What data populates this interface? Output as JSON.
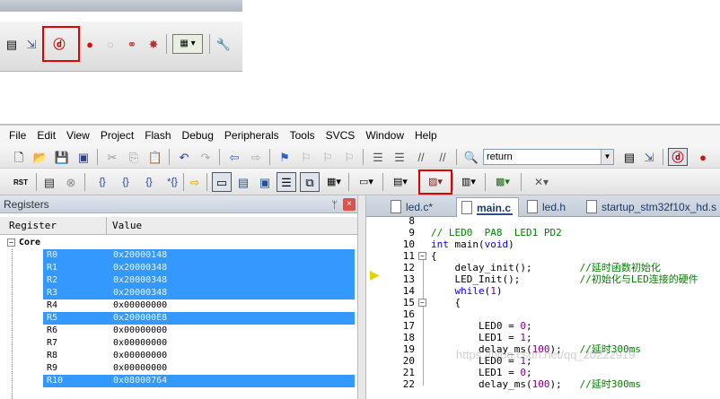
{
  "menubar": [
    "File",
    "Edit",
    "View",
    "Project",
    "Flash",
    "Debug",
    "Peripherals",
    "Tools",
    "SVCS",
    "Window",
    "Help"
  ],
  "toolbar": {
    "find_combo_value": "return",
    "rst_label": "RST"
  },
  "registers": {
    "title": "Registers",
    "col_register": "Register",
    "col_value": "Value",
    "group": "Core",
    "rows": [
      {
        "name": "R0",
        "value": "0x20000148",
        "selected": true
      },
      {
        "name": "R1",
        "value": "0x20000348",
        "selected": true
      },
      {
        "name": "R2",
        "value": "0x20000348",
        "selected": true
      },
      {
        "name": "R3",
        "value": "0x20000348",
        "selected": true
      },
      {
        "name": "R4",
        "value": "0x00000000",
        "selected": false
      },
      {
        "name": "R5",
        "value": "0x200000E8",
        "selected": true
      },
      {
        "name": "R6",
        "value": "0x00000000",
        "selected": false
      },
      {
        "name": "R7",
        "value": "0x00000000",
        "selected": false
      },
      {
        "name": "R8",
        "value": "0x00000000",
        "selected": false
      },
      {
        "name": "R9",
        "value": "0x00000000",
        "selected": false
      },
      {
        "name": "R10",
        "value": "0x08000764",
        "selected": true
      }
    ]
  },
  "editor": {
    "tabs": [
      "led.c*",
      "main.c",
      "led.h",
      "startup_stm32f10x_hd.s"
    ],
    "active_tab": 1,
    "lines": [
      {
        "no": "8",
        "code": ""
      },
      {
        "no": "9",
        "code": "// LED0  PA8  LED1 PD2"
      },
      {
        "no": "10",
        "code": "int main(void)"
      },
      {
        "no": "11",
        "code": "{"
      },
      {
        "no": "12",
        "code": "    delay_init();        //延时函数初始化"
      },
      {
        "no": "13",
        "code": "    LED_Init();          //初始化与LED连接的硬件"
      },
      {
        "no": "14",
        "code": "    while(1)"
      },
      {
        "no": "15",
        "code": "    {"
      },
      {
        "no": "16",
        "code": ""
      },
      {
        "no": "17",
        "code": "        LED0 = 0;"
      },
      {
        "no": "18",
        "code": "        LED1 = 1;"
      },
      {
        "no": "19",
        "code": "        delay_ms(100);   //延时300ms"
      },
      {
        "no": "20",
        "code": "        LED0 = 1;"
      },
      {
        "no": "21",
        "code": "        LED1 = 0;"
      },
      {
        "no": "22",
        "code": "        delay_ms(100);   //延时300ms"
      }
    ],
    "watermark": "https://blog.csdn.net/qq_20222919"
  }
}
